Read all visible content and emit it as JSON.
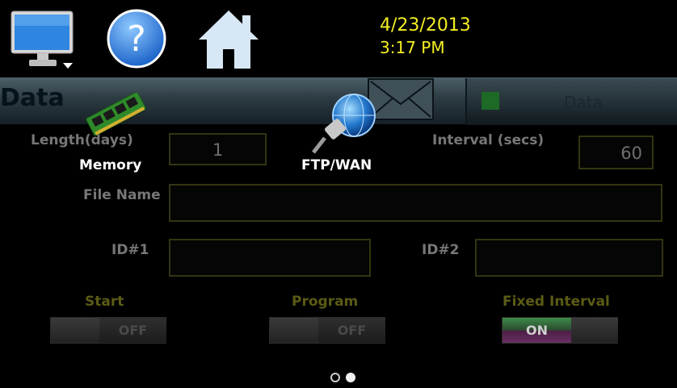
{
  "topbar": {
    "monitor_icon": "monitor-icon",
    "help_icon": "help-icon",
    "home_icon": "home-icon",
    "date": "4/23/2013",
    "time": "3:17 PM"
  },
  "header": {
    "title": "Data",
    "data_tab_label": "Data",
    "envelope_icon": "envelope-icon"
  },
  "overlay": {
    "memory_label": "Memory",
    "ftp_label": "FTP/WAN"
  },
  "form": {
    "length_label": "Length(days)",
    "length_value": "1",
    "interval_label": "Interval (secs)",
    "interval_value": "60",
    "file_name_label": "File Name",
    "file_name_value": "",
    "id1_label": "ID#1",
    "id1_value": "",
    "id2_label": "ID#2",
    "id2_value": ""
  },
  "toggles": {
    "start_label": "Start",
    "start_state": "OFF",
    "program_label": "Program",
    "program_state": "OFF",
    "fixed_interval_label": "Fixed Interval",
    "fixed_interval_state": "ON"
  },
  "pager": {
    "current_page": 2,
    "total_pages": 2
  },
  "colors": {
    "datetime": "#f3ef22",
    "on_green": "#3f8a4a",
    "on_magenta": "#6a2e63",
    "status_led": "#1c6a26"
  }
}
